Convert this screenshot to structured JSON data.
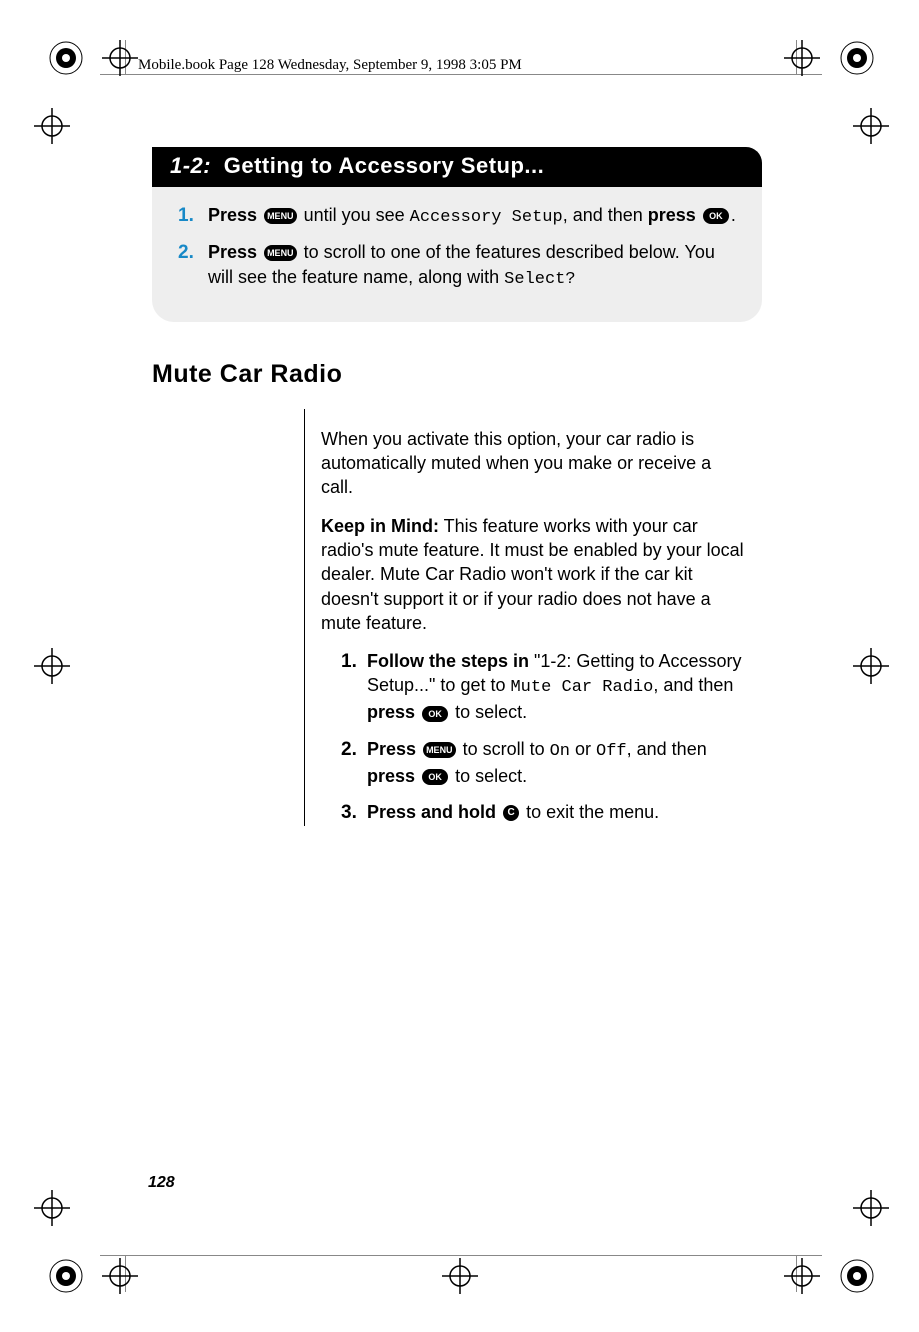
{
  "running_head": "Mobile.book  Page 128  Wednesday, September 9, 1998  3:05 PM",
  "banner": {
    "prefix": "1-2:",
    "title": " Getting to Accessory Setup..."
  },
  "grey_steps": [
    {
      "num": "1.",
      "pre_bold": "Press",
      "btn1": "MENU",
      "mid": " until you see ",
      "lcd": "Accessory Setup",
      "after_lcd": ", and then ",
      "bold2": "press",
      "btn2": "OK",
      "tail": "."
    },
    {
      "num": "2.",
      "pre_bold": "Press",
      "btn1": "MENU",
      "mid": " to scroll to one of the features described below. You will see the feature name, along with ",
      "lcd": "Select?"
    }
  ],
  "h2": "Mute Car Radio",
  "para1": "When you activate this option, your car radio is automatically muted when you make or receive a call.",
  "para2_lead": "Keep in Mind:",
  "para2_rest": " This feature works with your car radio's mute feature. It must be enabled by your local dealer. Mute Car Radio won't work if the car kit doesn't support it or if your radio does not have a mute feature.",
  "sub_steps": {
    "s1": {
      "num": "1.",
      "lead_bold": "Follow the steps in",
      "quote": " \"1-2: Getting to Accessory Setup...\" to get to ",
      "lcd": "Mute Car Radio",
      "after": ", and then ",
      "bold2": "press",
      "btn": "OK",
      "tail": " to select."
    },
    "s2": {
      "num": "2.",
      "lead_bold": "Press",
      "btn1": "MENU",
      "mid": " to scroll to ",
      "lcd1": "On",
      "or": " or ",
      "lcd2": "Off",
      "after": ", and then ",
      "bold2": "press",
      "btn2": "OK",
      "tail": " to select."
    },
    "s3": {
      "num": "3.",
      "lead_bold": "Press and hold",
      "btn": "C",
      "tail": " to exit the menu."
    }
  },
  "page_number": "128",
  "icons": {
    "menu": "MENU",
    "ok": "OK",
    "c": "C"
  }
}
